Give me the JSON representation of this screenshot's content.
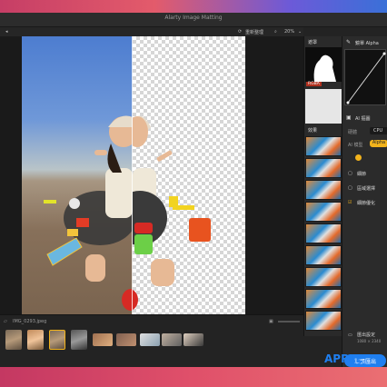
{
  "window": {
    "title": "Alarty Image Matting"
  },
  "toolbar": {
    "reset_label": "重新整理",
    "zoom": "20%"
  },
  "file": {
    "name": "IMG_0293.jpeg"
  },
  "sidebar": {
    "mask_heading": "遮罩",
    "mask_badge": "RGBA",
    "effects_heading": "效果"
  },
  "panel": {
    "alpha_heading": "鏡單 Alpha",
    "ai_heading": "AI 摳圖",
    "device_label": "硬體",
    "device_value": "CPU",
    "model_label": "AI 模型",
    "model_value": "Alpha",
    "options": [
      {
        "label": "細節"
      },
      {
        "label": "區域選擇"
      },
      {
        "label": "細節優化"
      }
    ],
    "export_label": "匯出設定",
    "export_size": "1080 × 2340",
    "export_button": "單張匯出"
  },
  "watermark": "APPLE",
  "colors": {
    "accent_orange": "#f2b31c",
    "accent_blue": "#1f7ff0",
    "bg": "#232323"
  }
}
